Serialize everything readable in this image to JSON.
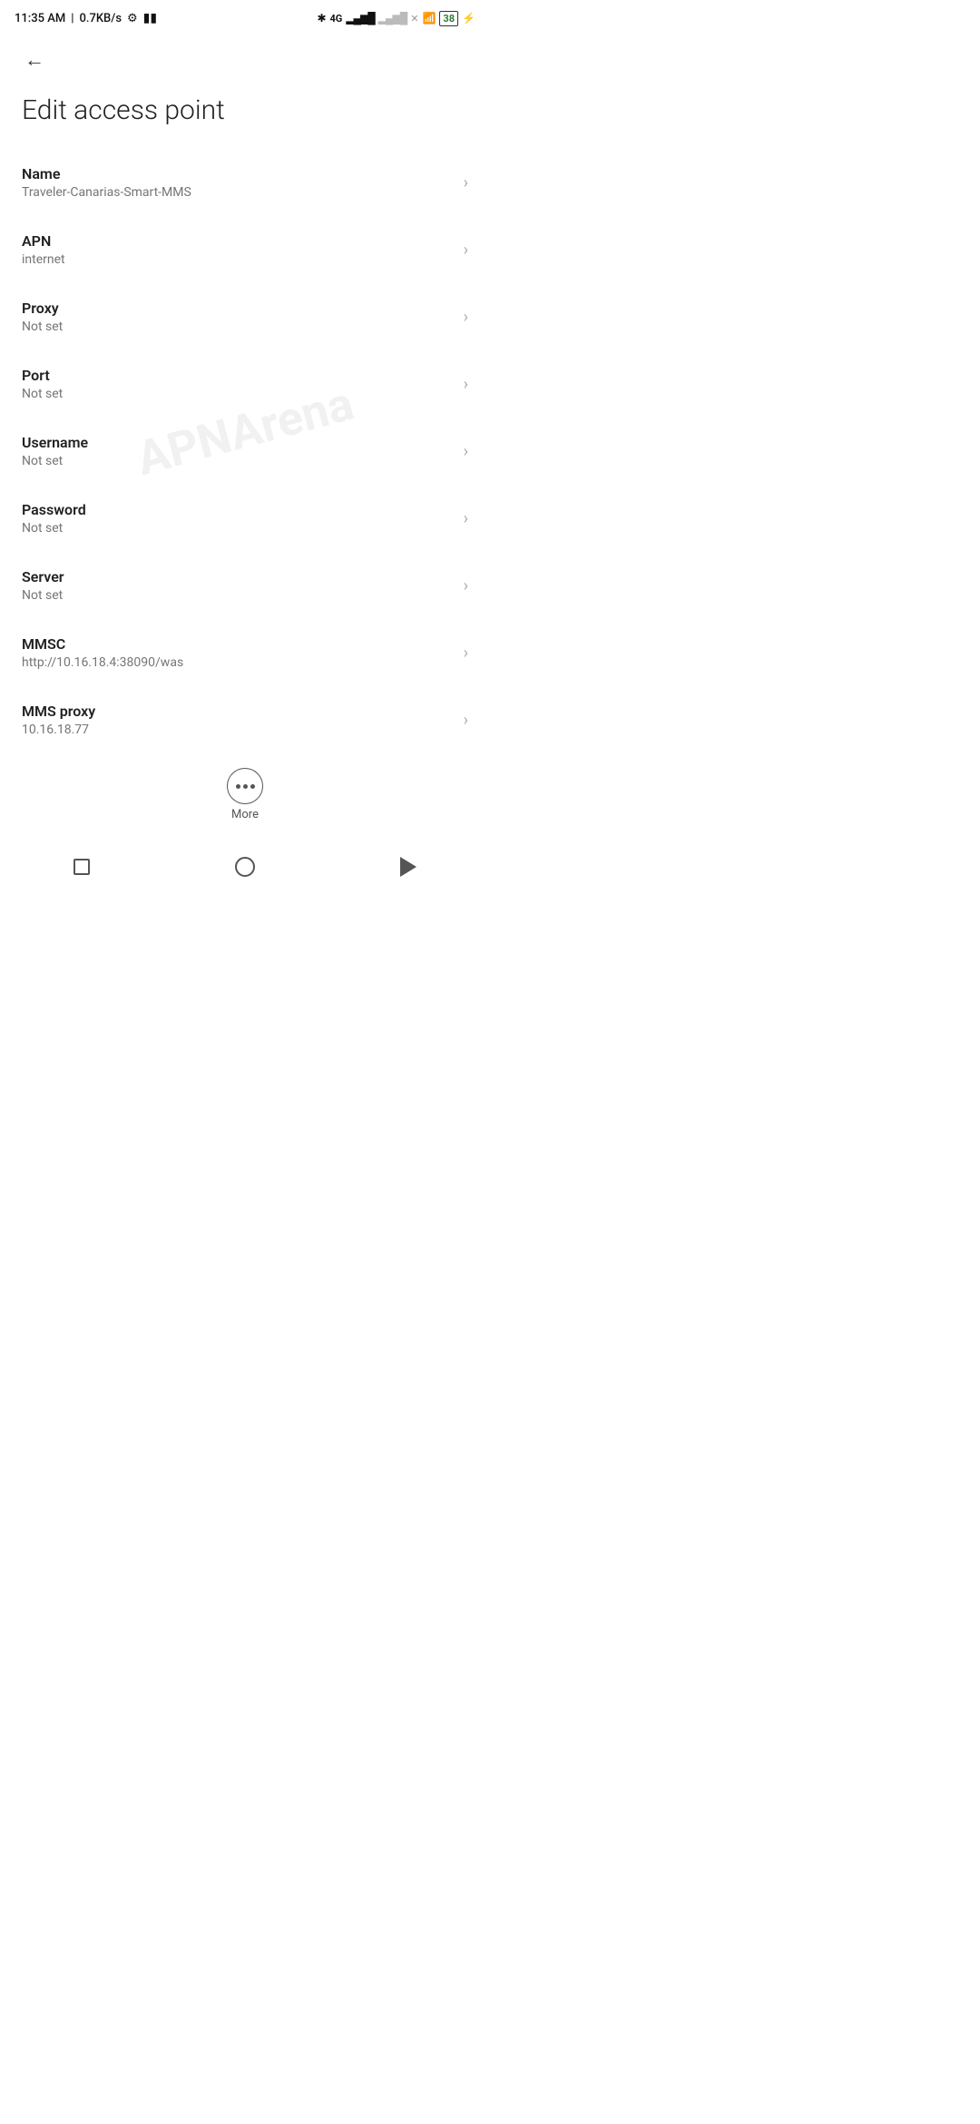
{
  "statusBar": {
    "time": "11:35 AM",
    "network": "0.7KB/s",
    "icons": {
      "settings": "⚙",
      "video": "▶",
      "bluetooth": "⚡",
      "signal4g": "4G",
      "wifi": "WiFi",
      "battery": "38",
      "bolt": "⚡"
    }
  },
  "toolbar": {
    "backLabel": "←"
  },
  "page": {
    "title": "Edit access point"
  },
  "settings": [
    {
      "id": "name",
      "label": "Name",
      "value": "Traveler-Canarias-Smart-MMS"
    },
    {
      "id": "apn",
      "label": "APN",
      "value": "internet"
    },
    {
      "id": "proxy",
      "label": "Proxy",
      "value": "Not set"
    },
    {
      "id": "port",
      "label": "Port",
      "value": "Not set"
    },
    {
      "id": "username",
      "label": "Username",
      "value": "Not set"
    },
    {
      "id": "password",
      "label": "Password",
      "value": "Not set"
    },
    {
      "id": "server",
      "label": "Server",
      "value": "Not set"
    },
    {
      "id": "mmsc",
      "label": "MMSC",
      "value": "http://10.16.18.4:38090/was"
    },
    {
      "id": "mms-proxy",
      "label": "MMS proxy",
      "value": "10.16.18.77"
    }
  ],
  "more": {
    "label": "More"
  },
  "watermark": "APNArena"
}
